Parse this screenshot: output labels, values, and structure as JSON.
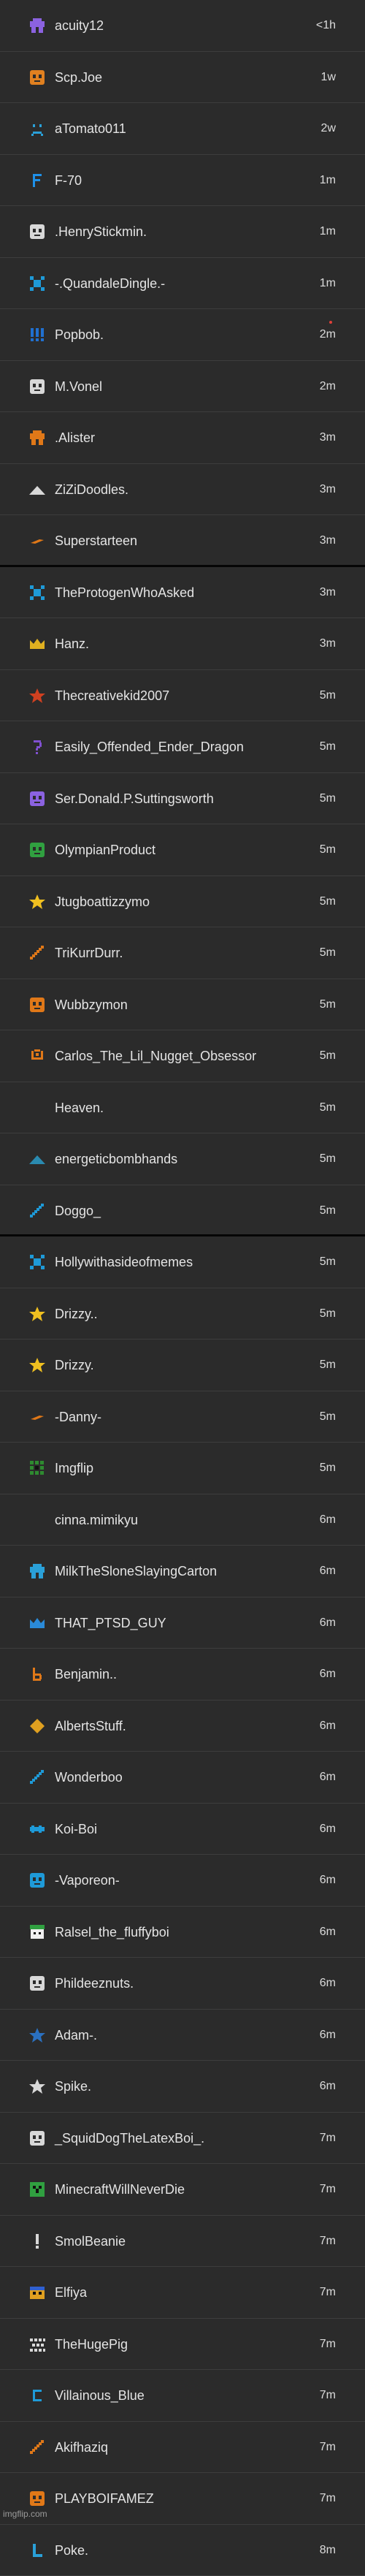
{
  "users": [
    {
      "name": "acuity12",
      "time": "<1h",
      "icon": "purple-pixel-avatar",
      "color": "#8b62e0"
    },
    {
      "name": "Scp.Joe",
      "time": "1w",
      "icon": "orange-pixel-face",
      "color": "#e08020"
    },
    {
      "name": "aTomato011",
      "time": "2w",
      "icon": "sad-face",
      "color": "#2aa0d8"
    },
    {
      "name": "F-70",
      "time": "1m",
      "icon": "letter-f",
      "color": "#1e90e8"
    },
    {
      "name": ".HenryStickmin.",
      "time": "1m",
      "icon": "white-pixel-face",
      "color": "#d8d8d8"
    },
    {
      "name": "-.QuandaleDingle.-",
      "time": "1m",
      "icon": "blue-pixel-x",
      "color": "#1e9ad8"
    },
    {
      "name": "Popbob.",
      "time": "2m",
      "icon": "exclamation-marks",
      "color": "#2070d0",
      "unread": true
    },
    {
      "name": "M.Vonel",
      "time": "2m",
      "icon": "white-pixel-face",
      "color": "#d8d8d8"
    },
    {
      "name": ".Alister",
      "time": "3m",
      "icon": "orange-pixel-blob",
      "color": "#e07818"
    },
    {
      "name": "ZiZiDoodles.",
      "time": "3m",
      "icon": "white-pyramid",
      "color": "#d8d8d8"
    },
    {
      "name": "Superstarteen",
      "time": "3m",
      "icon": "orange-dash",
      "color": "#e07818"
    },
    {
      "name": "TheProtogenWhoAsked",
      "time": "3m",
      "icon": "blue-pixel-x",
      "color": "#1e9ad8"
    },
    {
      "name": "Hanz.",
      "time": "3m",
      "icon": "gold-crown",
      "color": "#e0b020"
    },
    {
      "name": "Thecreativekid2007",
      "time": "5m",
      "icon": "red-star",
      "color": "#d04020"
    },
    {
      "name": "Easily_Offended_Ender_Dragon",
      "time": "5m",
      "icon": "question-mark",
      "color": "#8050d0"
    },
    {
      "name": "Ser.Donald.P.Suttingsworth",
      "time": "5m",
      "icon": "purple-pixel-face",
      "color": "#8b62e0"
    },
    {
      "name": "OlympianProduct",
      "time": "5m",
      "icon": "green-pixel-face",
      "color": "#30a040"
    },
    {
      "name": "Jtugboattizzymo",
      "time": "5m",
      "icon": "yellow-star",
      "color": "#f0c020"
    },
    {
      "name": "TriKurrDurr.",
      "time": "5m",
      "icon": "orange-slash",
      "color": "#e07818"
    },
    {
      "name": "Wubbzymon",
      "time": "5m",
      "icon": "orange-pixel-face",
      "color": "#e07818"
    },
    {
      "name": "Carlos_The_Lil_Nugget_Obsessor",
      "time": "5m",
      "icon": "orange-smile",
      "color": "#e07818"
    },
    {
      "name": "Heaven.",
      "time": "5m",
      "icon": "none",
      "color": "#2b2b2b"
    },
    {
      "name": "energeticbombhands",
      "time": "5m",
      "icon": "dotted-pyramid",
      "color": "#2a8ab0"
    },
    {
      "name": "Doggo_",
      "time": "5m",
      "icon": "blue-slash",
      "color": "#1e9ad8"
    },
    {
      "name": "Hollywithasideofmemes",
      "time": "5m",
      "icon": "blue-pixel-x",
      "color": "#1e9ad8"
    },
    {
      "name": "Drizzy..",
      "time": "5m",
      "icon": "yellow-star",
      "color": "#f0c020"
    },
    {
      "name": "Drizzy.",
      "time": "5m",
      "icon": "yellow-star",
      "color": "#f0c020"
    },
    {
      "name": "-Danny-",
      "time": "5m",
      "icon": "orange-dash",
      "color": "#e07818"
    },
    {
      "name": "Imgflip",
      "time": "5m",
      "icon": "green-pixel-grid",
      "color": "#2e8a30"
    },
    {
      "name": "cinna.mimikyu",
      "time": "6m",
      "icon": "none",
      "color": "#2b2b2b"
    },
    {
      "name": "MilkTheSloneSlayingCarton",
      "time": "6m",
      "icon": "blue-pixel-blob",
      "color": "#2aa0d8"
    },
    {
      "name": "THAT_PTSD_GUY",
      "time": "6m",
      "icon": "blue-crown",
      "color": "#2a8ad8"
    },
    {
      "name": "Benjamin..",
      "time": "6m",
      "icon": "letter-b",
      "color": "#e07818"
    },
    {
      "name": "AlbertsStuff.",
      "time": "6m",
      "icon": "orange-diamond",
      "color": "#e0a020"
    },
    {
      "name": "Wonderboo",
      "time": "6m",
      "icon": "blue-slash",
      "color": "#1e9ad8"
    },
    {
      "name": "Koi-Boi",
      "time": "6m",
      "icon": "blue-fish",
      "color": "#1e9ad8"
    },
    {
      "name": "-Vaporeon-",
      "time": "6m",
      "icon": "blue-pixel-face",
      "color": "#1e9ad8"
    },
    {
      "name": "Ralsel_the_fluffyboi",
      "time": "6m",
      "icon": "ralsei-face",
      "color": "#30a040"
    },
    {
      "name": "Phildeeznuts.",
      "time": "6m",
      "icon": "white-pixel-face",
      "color": "#d8d8d8"
    },
    {
      "name": "Adam-.",
      "time": "6m",
      "icon": "blue-star",
      "color": "#2a70c0"
    },
    {
      "name": "Spike.",
      "time": "6m",
      "icon": "white-star",
      "color": "#d8d8d8"
    },
    {
      "name": "_SquidDogTheLatexBoi_.",
      "time": "7m",
      "icon": "white-pixel-face",
      "color": "#d8d8d8"
    },
    {
      "name": "MinecraftWillNeverDie",
      "time": "7m",
      "icon": "green-creeper",
      "color": "#30a040"
    },
    {
      "name": "SmolBeanie",
      "time": "7m",
      "icon": "exclamation-mark",
      "color": "#d8d8d8"
    },
    {
      "name": "Elfiya",
      "time": "7m",
      "icon": "rainbow-face",
      "color": "#e0a020"
    },
    {
      "name": "TheHugePig",
      "time": "7m",
      "icon": "black-white-pattern",
      "color": "#d8d8d8"
    },
    {
      "name": "Villainous_Blue",
      "time": "7m",
      "icon": "letter-c",
      "color": "#1e9ad8"
    },
    {
      "name": "Akifhaziq",
      "time": "7m",
      "icon": "orange-slash",
      "color": "#e07818"
    },
    {
      "name": "PLAYBOIFAMEZ",
      "time": "7m",
      "icon": "orange-pixel-face",
      "color": "#e07818"
    },
    {
      "name": "Poke.",
      "time": "8m",
      "icon": "blue-letter-l",
      "color": "#2aa0d8"
    }
  ],
  "watermark": "imgflip.com"
}
